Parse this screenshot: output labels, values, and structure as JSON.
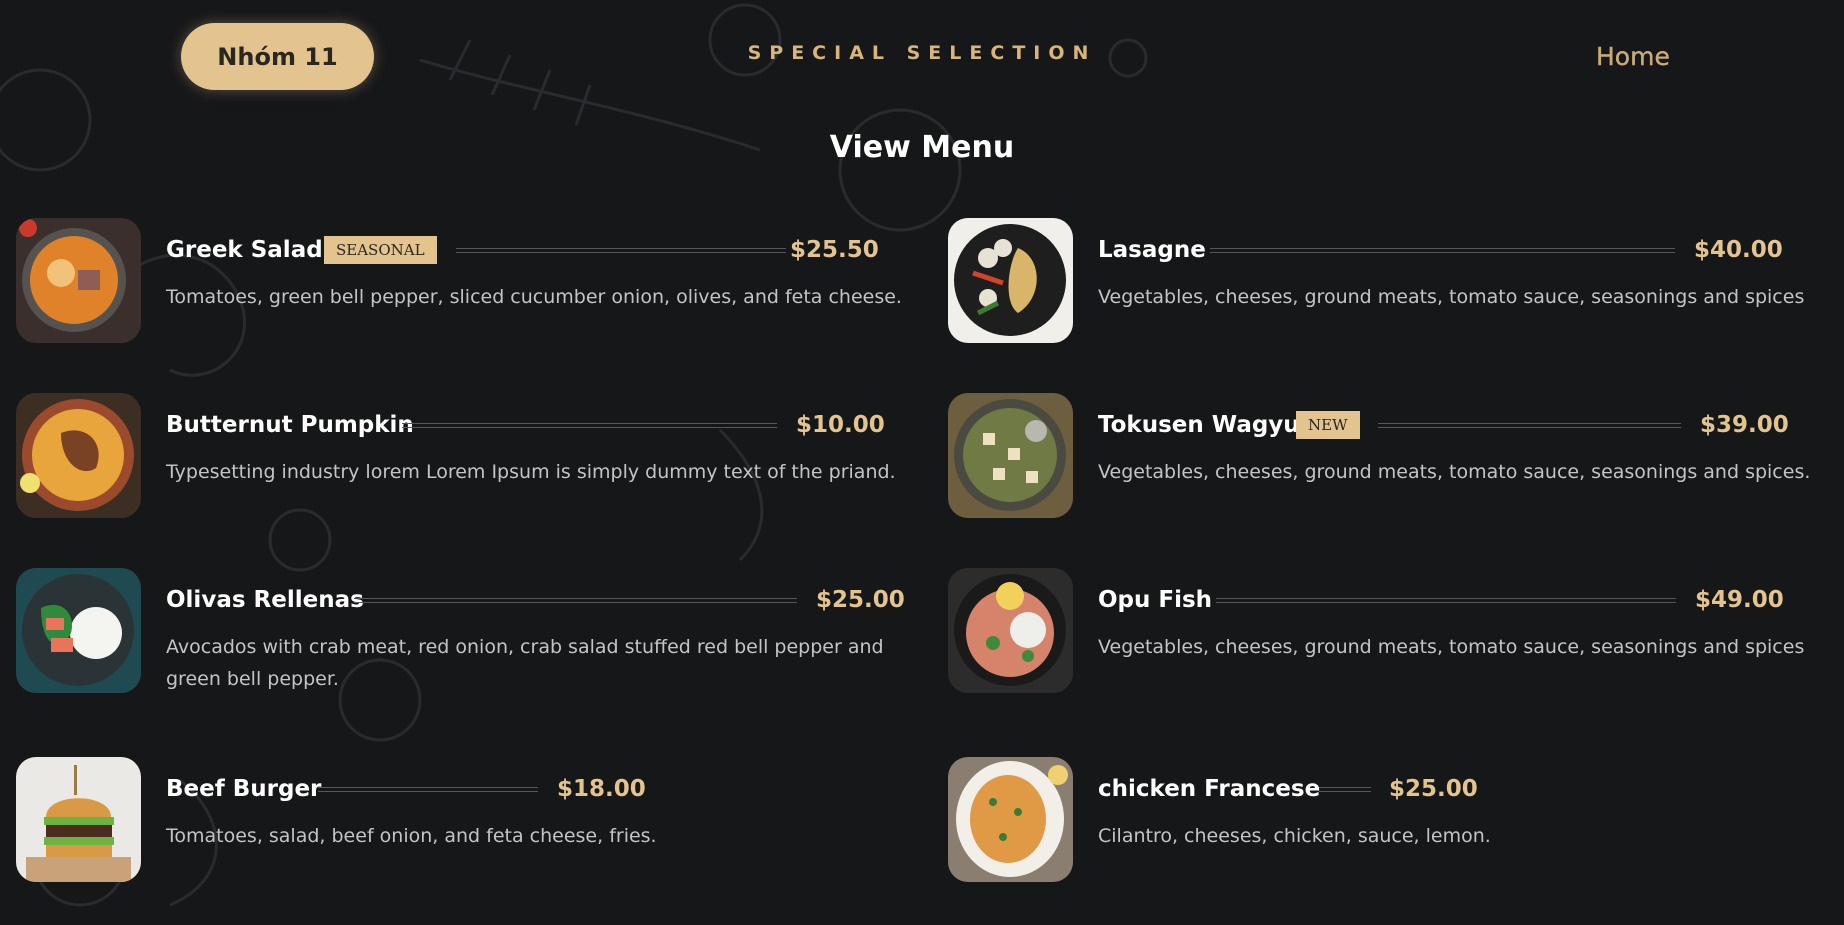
{
  "header": {
    "group_label": "Nhóm 11",
    "special_label": "SPECIAL SELECTION",
    "home_label": "Home"
  },
  "page": {
    "title": "View Menu"
  },
  "menu": {
    "items": [
      {
        "name": "Greek Salad",
        "badge": "SEASONAL",
        "price": "$25.50",
        "description": "Tomatoes, green bell pepper, sliced cucumber onion, olives, and feta cheese.",
        "image": "curry-bowl"
      },
      {
        "name": "Lasagne",
        "price": "$40.00",
        "description": "Vegetables, cheeses, ground meats, tomato sauce, seasonings and spices",
        "image": "noodle-bowl"
      },
      {
        "name": "Butternut Pumpkin",
        "price": "$10.00",
        "description": "Typesetting industry lorem Lorem Ipsum is simply dummy text of the priand.",
        "image": "rice-dish"
      },
      {
        "name": "Tokusen Wagyu",
        "badge": "NEW",
        "price": "$39.00",
        "description": "Vegetables, cheeses, ground meats, tomato sauce, seasonings and spices.",
        "image": "green-curry"
      },
      {
        "name": "Olivas Rellenas",
        "price": "$25.00",
        "description": "Avocados with crab meat, red onion, crab salad stuffed red bell pepper and green bell pepper.",
        "image": "salad-rice"
      },
      {
        "name": "Opu Fish",
        "price": "$49.00",
        "description": "Vegetables, cheeses, ground meats, tomato sauce, seasonings and spices",
        "image": "shrimp-rice"
      },
      {
        "name": "Beef Burger",
        "price": "$18.00",
        "description": "Tomatoes, salad, beef onion, and feta cheese, fries.",
        "image": "burger"
      },
      {
        "name": "chicken Francese",
        "price": "$25.00",
        "description": "Cilantro, cheeses, chicken, sauce, lemon.",
        "image": "chicken-plate"
      }
    ]
  },
  "colors": {
    "background": "#161719",
    "accent": "#e3c48e",
    "text": "#ffffff",
    "muted_text": "#c4c4c4"
  }
}
